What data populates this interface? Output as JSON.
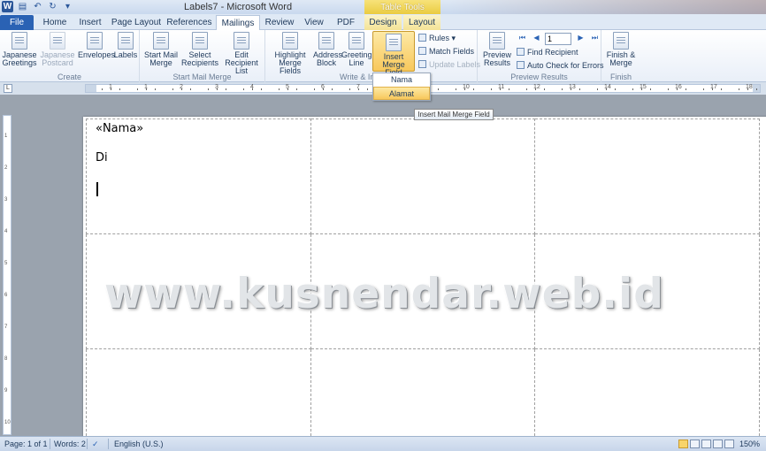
{
  "window": {
    "title": "Labels7  -  Microsoft Word",
    "contextual_header": "Table Tools"
  },
  "tabs": [
    "File",
    "Home",
    "Insert",
    "Page Layout",
    "References",
    "Mailings",
    "Review",
    "View",
    "PDF",
    "Design",
    "Layout"
  ],
  "active_tab": "Mailings",
  "ribbon": {
    "create": {
      "label": "Create",
      "japanese_greetings": "Japanese Greetings",
      "japanese_postcard": "Japanese Postcard",
      "envelopes": "Envelopes",
      "labels": "Labels"
    },
    "start_mail_merge": {
      "label": "Start Mail Merge",
      "start": "Start Mail Merge",
      "select_recipients": "Select Recipients",
      "edit_list": "Edit Recipient List"
    },
    "write_insert": {
      "label": "Write & In",
      "highlight": "Highlight Merge Fields",
      "address_block": "Address Block",
      "greeting_line": "Greeting Line",
      "insert_merge_field": "Insert Merge Field",
      "rules": "Rules",
      "match_fields": "Match Fields",
      "update_labels": "Update Labels"
    },
    "preview": {
      "label": "Preview Results",
      "preview_results": "Preview Results",
      "record": "1",
      "find_recipient": "Find Recipient",
      "auto_check": "Auto Check for Errors"
    },
    "finish": {
      "label": "Finish",
      "finish_merge": "Finish & Merge"
    }
  },
  "dropdown": {
    "items": [
      "Nama",
      "Alamat"
    ],
    "hovered": "Alamat"
  },
  "tooltip": "Insert Mail Merge Field",
  "ruler": {
    "h_labels": [
      "1",
      "1",
      "2",
      "3",
      "4",
      "5",
      "6",
      "7",
      "8",
      "9",
      "10",
      "11",
      "12",
      "13",
      "14",
      "15",
      "16",
      "17",
      "18",
      "19"
    ],
    "v_labels": [
      "1",
      "2",
      "3",
      "4",
      "5",
      "6",
      "7",
      "8",
      "9",
      "10"
    ],
    "corner": "L"
  },
  "document": {
    "cell1_line1": "«Nama»",
    "cell1_line2": "Di"
  },
  "watermark": "www.kusnendar.web.id",
  "status": {
    "page": "Page: 1 of 1",
    "words": "Words: 2",
    "language": "English (U.S.)",
    "zoom": "150%"
  }
}
